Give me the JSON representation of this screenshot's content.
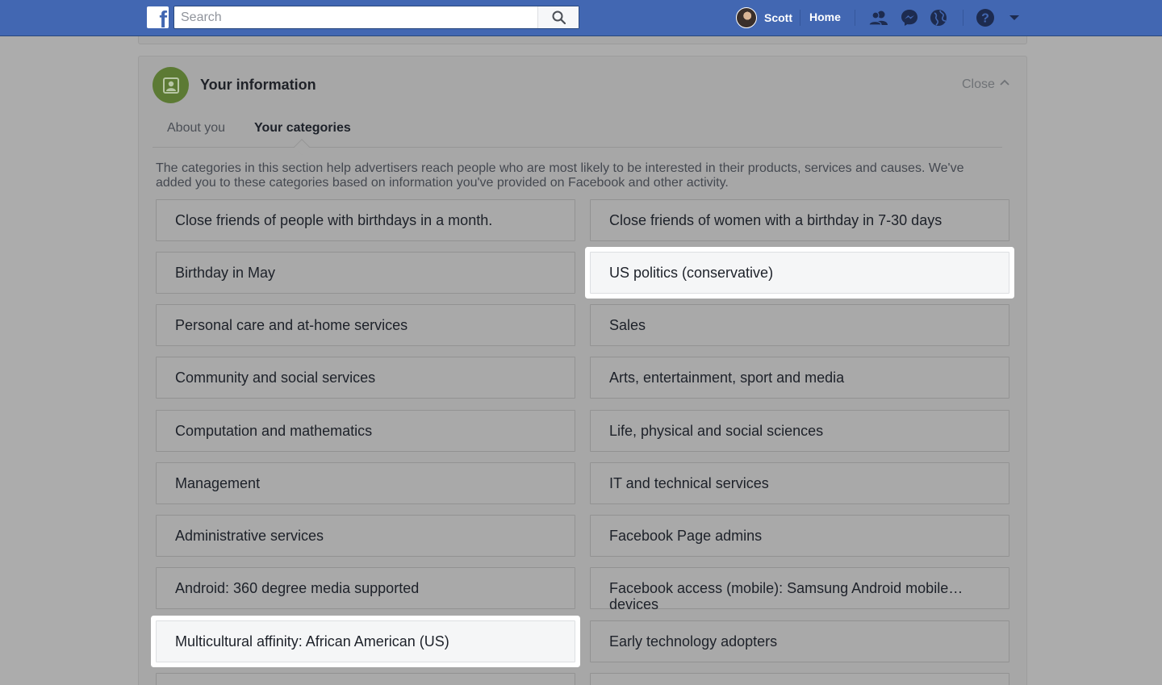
{
  "topbar": {
    "search_placeholder": "Search",
    "profile_name": "Scott",
    "home_label": "Home",
    "colors": {
      "bar": "#4267b2"
    }
  },
  "section": {
    "title": "Your information",
    "close_label": "Close",
    "tabs": [
      {
        "label": "About you",
        "active": false
      },
      {
        "label": "Your categories",
        "active": true
      }
    ],
    "intro": "The categories in this section help advertisers reach people who are most likely to be interested in their products, services and causes. We've added you to these categories based on information you've provided on Facebook and other activity."
  },
  "categories": [
    {
      "label": "Close friends of people with birthdays in a month.",
      "highlighted": false
    },
    {
      "label": "Close friends of women with a birthday in 7-30 days",
      "highlighted": false
    },
    {
      "label": "Birthday in May",
      "highlighted": false
    },
    {
      "label": "US politics (conservative)",
      "highlighted": true
    },
    {
      "label": "Personal care and at-home services",
      "highlighted": false
    },
    {
      "label": "Sales",
      "highlighted": false
    },
    {
      "label": "Community and social services",
      "highlighted": false
    },
    {
      "label": "Arts, entertainment, sport and media",
      "highlighted": false
    },
    {
      "label": "Computation and mathematics",
      "highlighted": false
    },
    {
      "label": "Life, physical and social sciences",
      "highlighted": false
    },
    {
      "label": "Management",
      "highlighted": false
    },
    {
      "label": "IT and technical services",
      "highlighted": false
    },
    {
      "label": "Administrative services",
      "highlighted": false
    },
    {
      "label": "Facebook Page admins",
      "highlighted": false
    },
    {
      "label": "Android: 360 degree media supported",
      "highlighted": false
    },
    {
      "label": "Facebook access (mobile): Samsung Android mobile… devices",
      "highlighted": false
    },
    {
      "label": "Multicultural affinity: African American (US)",
      "highlighted": true
    },
    {
      "label": "Early technology adopters",
      "highlighted": false
    },
    {
      "label": "",
      "highlighted": false
    },
    {
      "label": "",
      "highlighted": false
    }
  ]
}
